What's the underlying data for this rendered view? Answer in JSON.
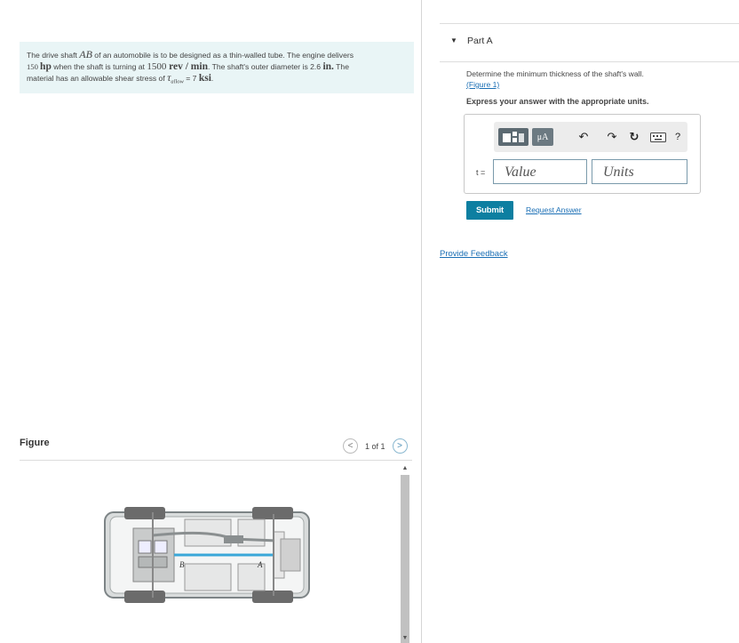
{
  "problem": {
    "t1": "The drive shaft ",
    "ab": "AB",
    "t2": " of an automobile is to be designed as a thin-walled tube. The engine delivers",
    "hp_num": "150 ",
    "hp_unit": "hp",
    "t3": " when the shaft is turning at ",
    "speed_num": "1500 ",
    "speed_unit": "rev / min",
    "t4": ". The shaft's outer diameter is 2.6 ",
    "dia_unit": "in.",
    "t5": " The",
    "t6": "material has an allowable shear stress of ",
    "tau": "τ",
    "tau_sub": "allow",
    "t7": " = 7 ",
    "stress_unit": "ksi",
    "t8": "."
  },
  "figure": {
    "label": "Figure",
    "nav_count": "1 of 1",
    "prev_glyph": "<",
    "next_glyph": ">",
    "point_b": "B",
    "point_a": "A"
  },
  "part": {
    "caret": "▼",
    "title": "Part A",
    "question": "Determine the minimum thickness of the shaft's wall.",
    "figure_link": "(Figure 1)",
    "instruction": "Express your answer with the appropriate units."
  },
  "toolbar": {
    "mu_label": "μA",
    "undo_icon": "↶",
    "redo_icon": "↷",
    "reset_icon": "↻",
    "help_label": "?"
  },
  "answer": {
    "variable": "t =",
    "value_placeholder": "Value",
    "units_placeholder": "Units"
  },
  "actions": {
    "submit": "Submit",
    "request_answer": "Request Answer",
    "feedback": "Provide Feedback"
  }
}
